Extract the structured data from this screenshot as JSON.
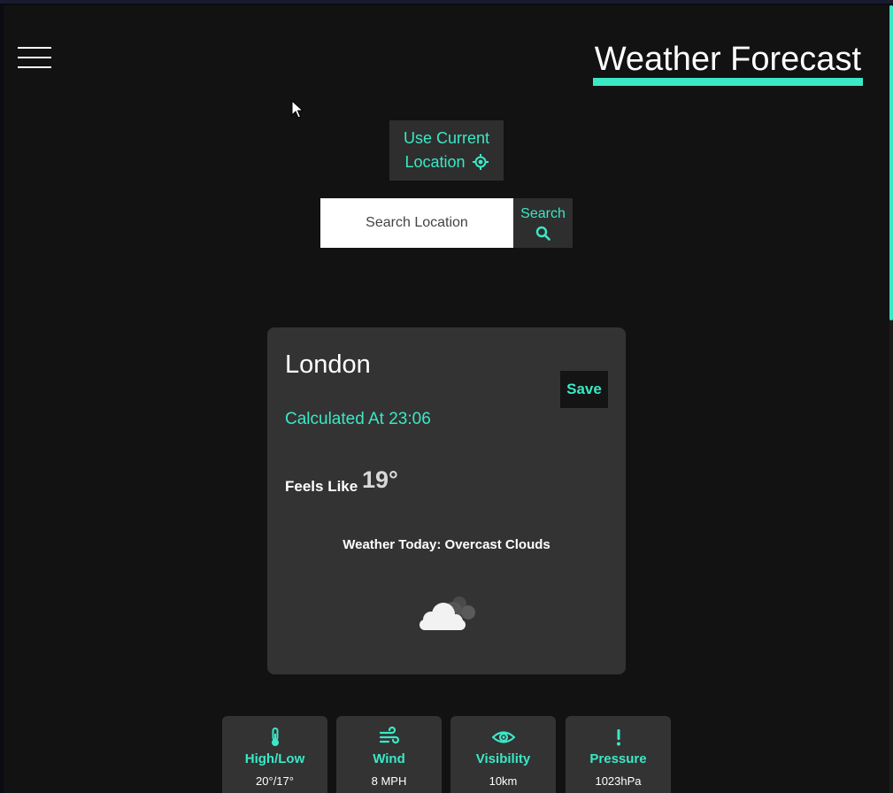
{
  "header": {
    "title": "Weather Forecast"
  },
  "location": {
    "use_current_line1": "Use Current",
    "use_current_line2": "Location"
  },
  "search": {
    "placeholder": "Search Location",
    "button_label": "Search"
  },
  "card": {
    "city": "London",
    "save_label": "Save",
    "calculated": "Calculated At 23:06",
    "feels_like_label": "Feels Like",
    "feels_like_value": "19°",
    "weather_today": "Weather Today: Overcast Clouds",
    "weather_icon": "overcast-clouds-icon"
  },
  "stats": [
    {
      "label": "High/Low",
      "value": "20°/17°",
      "icon": "thermometer-icon"
    },
    {
      "label": "Wind",
      "value": "8 MPH",
      "icon": "wind-icon"
    },
    {
      "label": "Visibility",
      "value": "10km",
      "icon": "eye-icon"
    },
    {
      "label": "Pressure",
      "value": "1023hPa",
      "icon": "exclamation-icon"
    }
  ],
  "colors": {
    "accent": "#3be8c6",
    "background": "#121212",
    "card": "#333333"
  }
}
